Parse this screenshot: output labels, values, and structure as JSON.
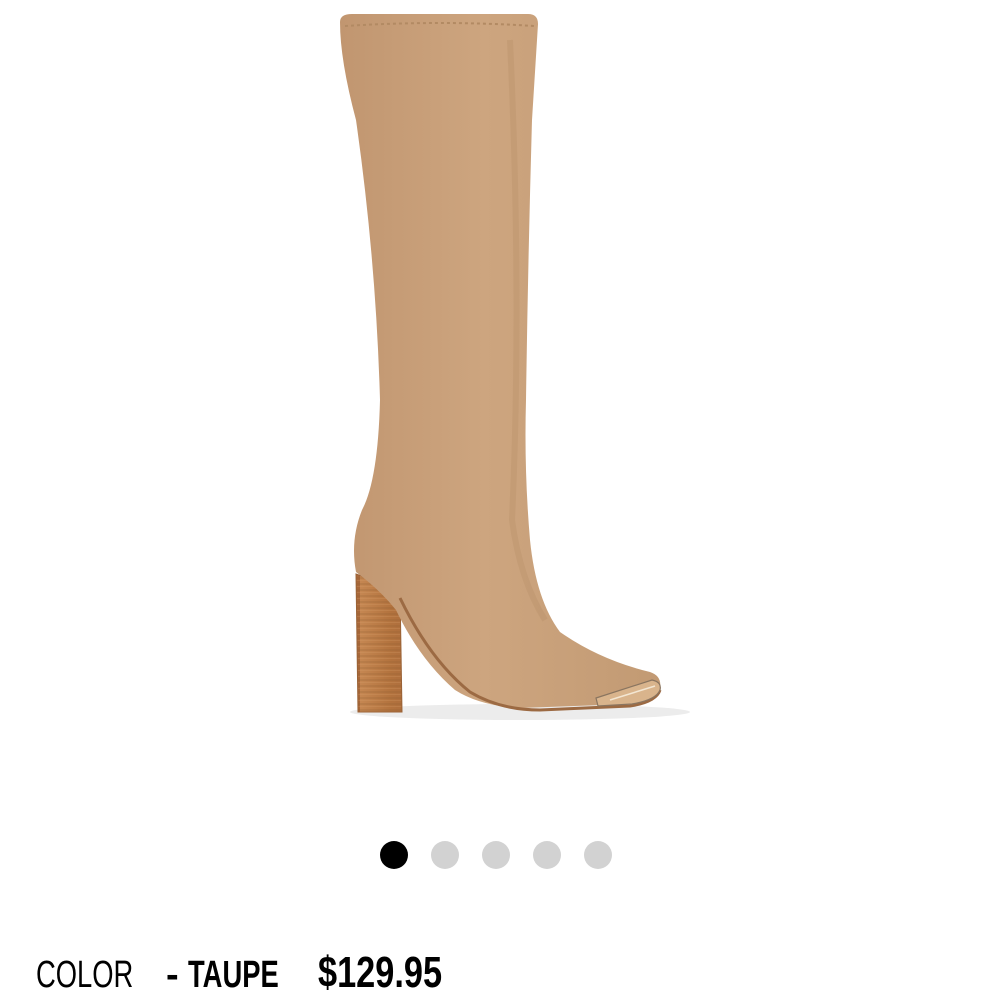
{
  "product": {
    "image_alt": "Taupe suede knee-high block heel boot",
    "color_label": "COLOR",
    "color_separator": "-",
    "color_value": "TAUPE",
    "price": "$129.95"
  },
  "carousel": {
    "total_slides": 5,
    "active_index": 0
  },
  "colors": {
    "boot_suede": "#c9a27b",
    "heel_wood": "#b77a45",
    "dot_active": "#000000",
    "dot_inactive": "#d2d2d2"
  }
}
